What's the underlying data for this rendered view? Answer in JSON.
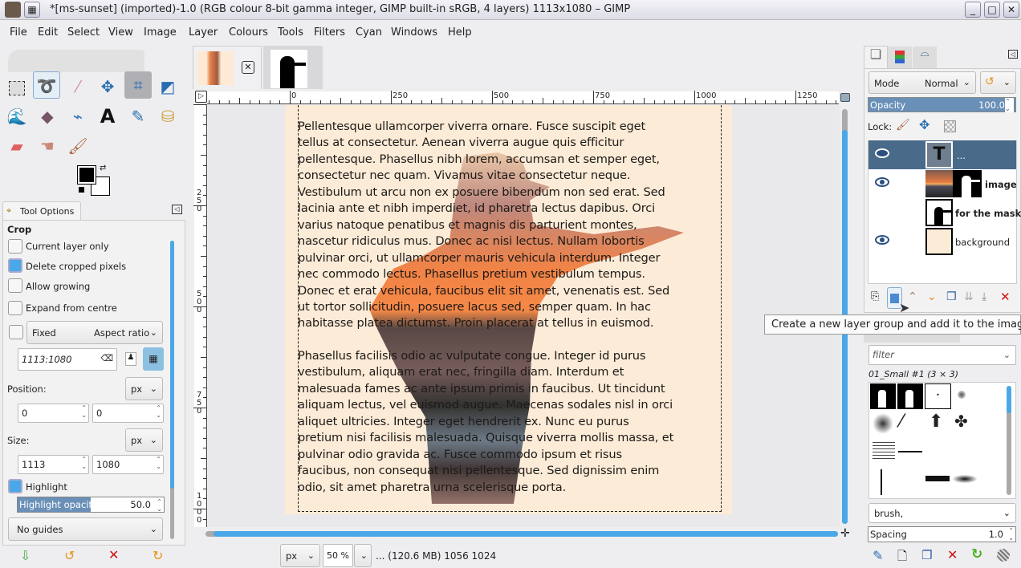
{
  "window": {
    "title": "*[ms-sunset] (imported)-1.0 (RGB colour 8-bit gamma integer, GIMP built-in sRGB, 4 layers) 1113x1080 – GIMP"
  },
  "menu": [
    "File",
    "Edit",
    "Select",
    "View",
    "Image",
    "Layer",
    "Colours",
    "Tools",
    "Filters",
    "Cyan",
    "Windows",
    "Help"
  ],
  "tool_options": {
    "tab": "Tool Options",
    "tool": "Crop",
    "current_layer_only": "Current layer only",
    "delete_cropped": "Delete cropped pixels",
    "allow_growing": "Allow growing",
    "expand_centre": "Expand from centre",
    "fixed": "Fixed",
    "fixed_mode": "Aspect ratio",
    "ratio": "1113:1080",
    "position_label": "Position:",
    "position_unit": "px",
    "pos_x": "0",
    "pos_y": "0",
    "size_label": "Size:",
    "size_unit": "px",
    "size_w": "1113",
    "size_h": "1080",
    "highlight": "Highlight",
    "highlight_opacity_label": "Highlight opacity",
    "highlight_opacity": "50.0",
    "highlight_opacity_fraction": 0.5,
    "guides": "No guides",
    "checks": {
      "current_layer_only": false,
      "delete_cropped": true,
      "allow_growing": false,
      "expand_centre": false,
      "fixed": false,
      "highlight": true
    }
  },
  "ruler": {
    "top": [
      "0",
      "250",
      "500",
      "750",
      "1000",
      "1250"
    ],
    "left": [
      "250",
      "500",
      "750",
      "1000"
    ]
  },
  "canvas": {
    "paragraph1": [
      "Pellentesque ullamcorper viverra ornare. Fusce suscipit eget",
      "tellus at consectetur. Aenean viverra augue quis efficitur",
      "pellentesque. Phasellus nibh lorem, accumsan et semper eget,",
      "consectetur nec quam. Vivamus vitae consectetur neque.",
      "Vestibulum ut arcu non ex posuere bibendum non sed erat. Sed",
      "lacinia ante et nibh imperdiet, id pharetra lectus dapibus. Orci",
      "varius natoque penatibus et magnis dis parturient montes,",
      "nascetur ridiculus mus. Donec ac nisi lectus. Nullam lobortis",
      "pulvinar orci, ut ullamcorper mauris vehicula interdum. Integer",
      "nec commodo lectus. Phasellus pretium vestibulum tempus.",
      "Donec et erat vehicula, faucibus elit sit amet, venenatis est. Sed",
      "ut tortor sollicitudin, posuere lacus sed, semper quam. In hac",
      "habitasse platea dictumst. Proin placerat at tellus in euismod."
    ],
    "paragraph2": [
      "Phasellus facilisis odio ac vulputate congue. Integer id purus",
      "vestibulum, aliquam erat nec, fringilla diam. Interdum et",
      "malesuada fames ac ante ipsum primis in faucibus. Ut tincidunt",
      "aliquam lectus, vel euismod augue. Maecenas sodales nisl in orci",
      "aliquet ultricies. Integer eget hendrerit ex. Nunc eu purus",
      "pretium nisi facilisis malesuada. Quisque viverra mollis massa, et",
      "pulvinar odio gravida ac. Fusce commodo ipsum et risus",
      "faucibus, non consequat nisi pellentesque. Sed dignissim enim",
      "odio, sit amet pharetra urna scelerisque porta."
    ]
  },
  "status": {
    "unit": "px",
    "zoom": "50 %",
    "info": "... (120.6 MB) 1056 1024"
  },
  "layers": {
    "mode_label": "Mode",
    "mode": "Normal",
    "opacity_label": "Opacity",
    "opacity": "100.0",
    "lock_label": "Lock:",
    "items": [
      {
        "name": "...",
        "visible": true
      },
      {
        "name": "image",
        "visible": true
      },
      {
        "name": "for the mask",
        "visible": false
      },
      {
        "name": "background",
        "visible": true
      }
    ]
  },
  "tooltip": "Create a new layer group and add it to the image",
  "brushes": {
    "filter_placeholder": "filter",
    "current": "01_Small #1 (3 × 3)",
    "tag": "brush,",
    "spacing_label": "Spacing",
    "spacing": "1.0"
  },
  "colors": {
    "accent": "#4aa8e8",
    "selected_row": "#4a6a8a",
    "image_bg": "#fdebd6"
  }
}
